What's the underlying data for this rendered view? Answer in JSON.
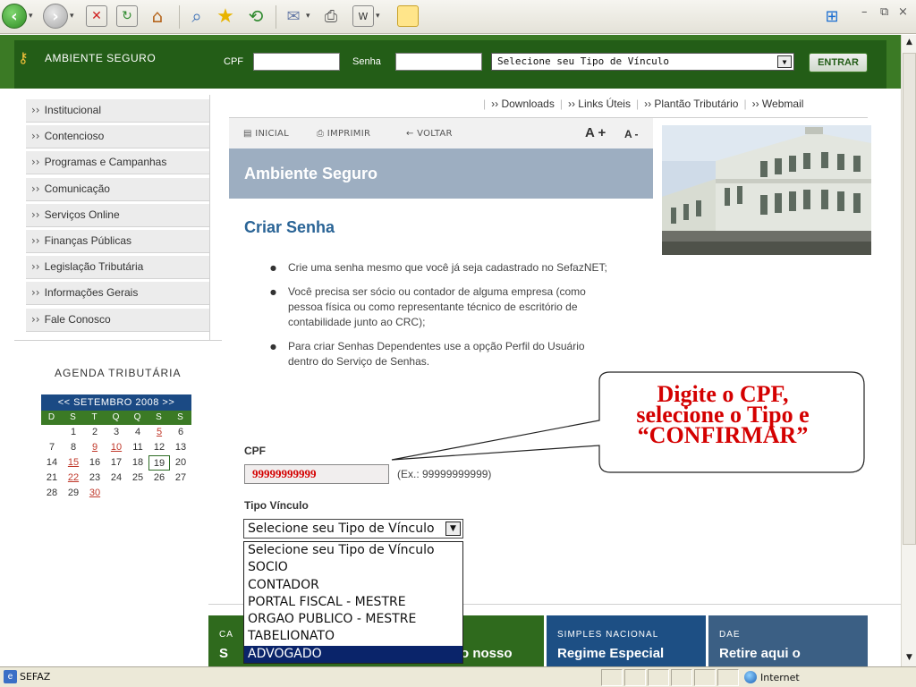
{
  "header": {
    "brand": "AMBIENTE SEGURO",
    "cpf_label": "CPF",
    "senha_label": "Senha",
    "vinculo_select": "Selecione seu Tipo de Vínculo",
    "entrar": "ENTRAR"
  },
  "menu": [
    "Institucional",
    "Contencioso",
    "Programas e Campanhas",
    "Comunicação",
    "Serviços Online",
    "Finanças Públicas",
    "Legislação Tributária",
    "Informações Gerais",
    "Fale Conosco"
  ],
  "agenda": {
    "title": "AGENDA TRIBUTÁRIA",
    "month_nav": "<< SETEMBRO  2008 >>",
    "weekdays": [
      "D",
      "S",
      "T",
      "Q",
      "Q",
      "S",
      "S"
    ],
    "days": [
      "",
      "1",
      "2",
      "3",
      "4",
      "5",
      "6",
      "7",
      "8",
      "9",
      "10",
      "11",
      "12",
      "13",
      "14",
      "15",
      "16",
      "17",
      "18",
      "19",
      "20",
      "21",
      "22",
      "23",
      "24",
      "25",
      "26",
      "27",
      "28",
      "29",
      "30"
    ],
    "highlight": [
      "5",
      "9",
      "10",
      "15",
      "22",
      "30"
    ],
    "today": "19"
  },
  "toplinks": [
    "›› Downloads",
    "›› Links Úteis",
    "›› Plantão Tributário",
    "›› Webmail"
  ],
  "strip": {
    "inicial": "INICIAL",
    "imprimir": "IMPRIMIR",
    "voltar": "← VOLTAR",
    "a_plus": "A +",
    "a_minus": "A -"
  },
  "banner_title": "Ambiente Seguro",
  "content_title": "Criar Senha",
  "bullets": [
    "Crie uma senha mesmo que você já seja cadastrado no SefazNET;",
    "Você precisa ser sócio ou contador de alguma empresa (como pessoa física ou como representante técnico de escritório de contabilidade junto ao CRC);",
    "Para criar Senhas Dependentes use a opção Perfil do Usuário dentro do Serviço de Senhas."
  ],
  "form": {
    "cpf_label": "CPF",
    "cpf_value": "99999999999",
    "cpf_hint": "(Ex.: 99999999999)",
    "vinculo_label": "Tipo Vínculo",
    "vinculo_selected": "Selecione seu Tipo de Vínculo",
    "vinculo_options": [
      "Selecione seu Tipo de Vínculo",
      "SOCIO",
      "CONTADOR",
      "PORTAL FISCAL - MESTRE",
      "ORGAO PUBLICO - MESTRE",
      "TABELIONATO",
      "ADVOGADO"
    ],
    "highlighted_option": 6
  },
  "callout": [
    "Digite o CPF,",
    "selecione o Tipo e",
    "“CONFIRMAR”"
  ],
  "tiles": [
    {
      "caption": "CA",
      "big": "S",
      "color": "#2f6a1d"
    },
    {
      "caption": "",
      "big": "o nosso",
      "color": "#2f6a1d"
    },
    {
      "caption": "SIMPLES NACIONAL",
      "big": "Regime Especial",
      "color": "#1d4f84"
    },
    {
      "caption": "DAE",
      "big": "Retire aqui o",
      "color": "#3b5f84"
    }
  ],
  "status": {
    "text": "SEFAZ",
    "zone": "Internet"
  }
}
